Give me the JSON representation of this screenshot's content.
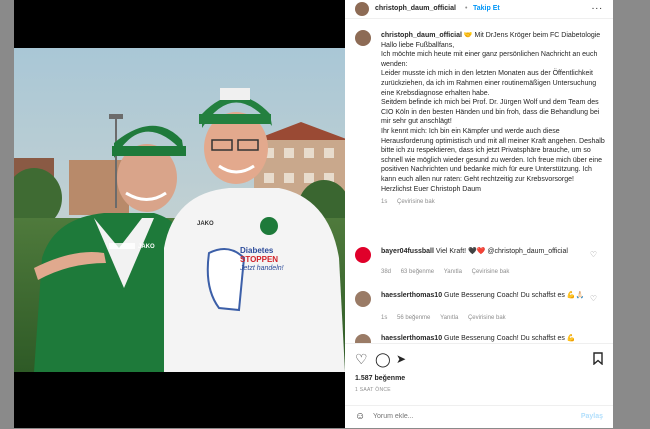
{
  "header": {
    "username": "christoph_daum_official",
    "separator": "•",
    "follow": "Takip Et",
    "more": "..."
  },
  "caption": {
    "username": "christoph_daum_official",
    "lines": [
      "🤝 Mit DrJens Kröger beim FC Diabetologie",
      "Hallo liebe Fußballfans,",
      "Ich möchte mich heute mit einer ganz persönlichen Nachricht an euch wenden:",
      "Leider musste ich mich in den letzten Monaten aus der Öffentlichkeit zurückziehen, da ich im Rahmen einer routinemäßigen Untersuchung eine Krebsdiagnose erhalten habe.",
      "Seitdem befinde ich mich bei Prof. Dr. Jürgen Wolf und dem Team des CIO Köln in den besten Händen und bin froh, dass die Behandlung bei mir sehr gut anschlägt!",
      "Ihr kennt mich: Ich bin ein Kämpfer und werde auch diese Herausforderung optimistisch und mit all meiner Kraft angehen. Deshalb bitte ich zu respektieren, dass ich jetzt Privatsphäre brauche, um so schnell wie möglich wieder gesund zu werden. Ich freue mich über eine positiven Nachrichten und bedanke mich für eure Unterstützung. Ich kann euch allen nur raten: Geht rechtzeitig zur Krebsvorsorge!",
      "Herzlichst Euer Christoph Daum"
    ],
    "time": "1s",
    "translate": "Çevirisine bak"
  },
  "comments": [
    {
      "username": "bayer04fussball",
      "text": "Viel Kraft! 🖤❤️ @christoph_daum_official",
      "time": "38d",
      "likes": "63 beğenme",
      "reply": "Yanıtla",
      "translate": "Çevirisine bak"
    },
    {
      "username": "haesslerthomas10",
      "text": "Gute Besserung Coach! Du schaffst es 💪🙏🏻",
      "time": "1s",
      "likes": "56 beğenme",
      "reply": "Yanıtla",
      "translate": "Çevirisine bak"
    },
    {
      "username": "haesslerthomas10",
      "text": "Gute Besserung Coach! Du schaffst es 💪"
    }
  ],
  "actions": {
    "likes": "1.587 beğenme",
    "time_ago": "1 SAAT ÖNCE"
  },
  "add_comment": {
    "placeholder": "Yorum ekle...",
    "post": "Paylaş"
  },
  "photo": {
    "shirt_brand": "JAKO",
    "shirt_line1": "Diabetes",
    "shirt_line2": "STOPPEN",
    "shirt_line3": "Jetzt handeln!",
    "jacket_brand": "JAKO"
  }
}
